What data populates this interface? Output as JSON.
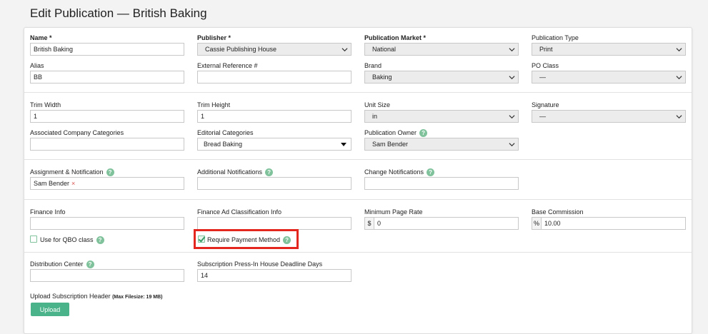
{
  "page": {
    "title": "Edit Publication — British Baking"
  },
  "form": {
    "name": {
      "label": "Name *",
      "value": "British Baking"
    },
    "publisher": {
      "label": "Publisher *",
      "value": "Cassie Publishing House"
    },
    "publication_market": {
      "label": "Publication Market *",
      "value": "National"
    },
    "publication_type": {
      "label": "Publication Type",
      "value": "Print"
    },
    "alias": {
      "label": "Alias",
      "value": "BB"
    },
    "external_reference": {
      "label": "External Reference #",
      "value": ""
    },
    "brand": {
      "label": "Brand",
      "value": "Baking"
    },
    "po_class": {
      "label": "PO Class",
      "value": "—"
    },
    "trim_width": {
      "label": "Trim Width",
      "value": "1"
    },
    "trim_height": {
      "label": "Trim Height",
      "value": "1"
    },
    "unit_size": {
      "label": "Unit Size",
      "value": "in"
    },
    "signature": {
      "label": "Signature",
      "value": "—"
    },
    "associated_company_categories": {
      "label": "Associated Company Categories",
      "value": ""
    },
    "editorial_categories": {
      "label": "Editorial Categories",
      "value": "Bread Baking"
    },
    "publication_owner": {
      "label": "Publication Owner",
      "value": "Sam Bender"
    },
    "assignment_notification": {
      "label": "Assignment & Notification",
      "tags": [
        "Sam Bender"
      ],
      "remove_glyph": "×"
    },
    "additional_notifications": {
      "label": "Additional Notifications",
      "value": ""
    },
    "change_notifications": {
      "label": "Change Notifications",
      "value": ""
    },
    "finance_info": {
      "label": "Finance Info",
      "value": ""
    },
    "finance_ad_classification": {
      "label": "Finance Ad Classification Info",
      "value": ""
    },
    "minimum_page_rate": {
      "label": "Minimum Page Rate",
      "prefix": "$",
      "value": "0"
    },
    "base_commission": {
      "label": "Base Commission",
      "prefix": "%",
      "value": "10.00"
    },
    "use_for_qbo": {
      "label": "Use for QBO class",
      "checked": false
    },
    "require_payment_method": {
      "label": "Require Payment Method",
      "checked": true
    },
    "distribution_center": {
      "label": "Distribution Center",
      "value": ""
    },
    "subscription_deadline": {
      "label": "Subscription Press-In House Deadline Days",
      "value": "14"
    },
    "upload": {
      "label": "Upload Subscription Header",
      "note": "(Max Filesize: 19 MB)",
      "button": "Upload"
    }
  },
  "icons": {
    "help": "?"
  },
  "colors": {
    "accent": "#4bb38a",
    "highlight": "#e3271e",
    "help": "#7fc29b"
  }
}
